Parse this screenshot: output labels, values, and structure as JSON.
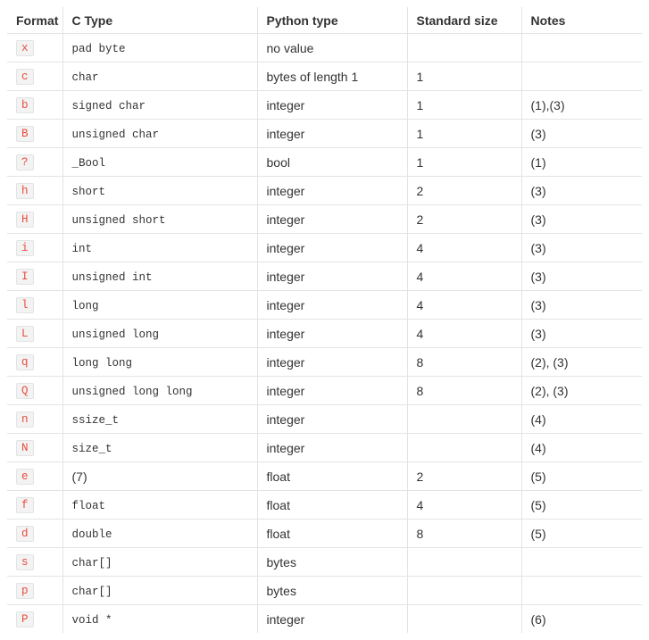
{
  "table": {
    "headers": [
      "Format",
      "C Type",
      "Python type",
      "Standard size",
      "Notes"
    ],
    "rows": [
      {
        "format": "x",
        "ctype": "pad byte",
        "ctype_mono": true,
        "ptype": "no value",
        "size": "",
        "notes": ""
      },
      {
        "format": "c",
        "ctype": "char",
        "ctype_mono": true,
        "ptype": "bytes of length 1",
        "size": "1",
        "notes": ""
      },
      {
        "format": "b",
        "ctype": "signed char",
        "ctype_mono": true,
        "ptype": "integer",
        "size": "1",
        "notes": "(1),(3)"
      },
      {
        "format": "B",
        "ctype": "unsigned char",
        "ctype_mono": true,
        "ptype": "integer",
        "size": "1",
        "notes": "(3)"
      },
      {
        "format": "?",
        "ctype": "_Bool",
        "ctype_mono": true,
        "ptype": "bool",
        "size": "1",
        "notes": "(1)"
      },
      {
        "format": "h",
        "ctype": "short",
        "ctype_mono": true,
        "ptype": "integer",
        "size": "2",
        "notes": "(3)"
      },
      {
        "format": "H",
        "ctype": "unsigned short",
        "ctype_mono": true,
        "ptype": "integer",
        "size": "2",
        "notes": "(3)"
      },
      {
        "format": "i",
        "ctype": "int",
        "ctype_mono": true,
        "ptype": "integer",
        "size": "4",
        "notes": "(3)"
      },
      {
        "format": "I",
        "ctype": "unsigned int",
        "ctype_mono": true,
        "ptype": "integer",
        "size": "4",
        "notes": "(3)"
      },
      {
        "format": "l",
        "ctype": "long",
        "ctype_mono": true,
        "ptype": "integer",
        "size": "4",
        "notes": "(3)"
      },
      {
        "format": "L",
        "ctype": "unsigned long",
        "ctype_mono": true,
        "ptype": "integer",
        "size": "4",
        "notes": "(3)"
      },
      {
        "format": "q",
        "ctype": "long long",
        "ctype_mono": true,
        "ptype": "integer",
        "size": "8",
        "notes": "(2), (3)"
      },
      {
        "format": "Q",
        "ctype": "unsigned long long",
        "ctype_mono": true,
        "ptype": "integer",
        "size": "8",
        "notes": "(2), (3)"
      },
      {
        "format": "n",
        "ctype": "ssize_t",
        "ctype_mono": true,
        "ptype": "integer",
        "size": "",
        "notes": "(4)"
      },
      {
        "format": "N",
        "ctype": "size_t",
        "ctype_mono": true,
        "ptype": "integer",
        "size": "",
        "notes": "(4)"
      },
      {
        "format": "e",
        "ctype": "(7)",
        "ctype_mono": false,
        "ptype": "float",
        "size": "2",
        "notes": "(5)"
      },
      {
        "format": "f",
        "ctype": "float",
        "ctype_mono": true,
        "ptype": "float",
        "size": "4",
        "notes": "(5)"
      },
      {
        "format": "d",
        "ctype": "double",
        "ctype_mono": true,
        "ptype": "float",
        "size": "8",
        "notes": "(5)"
      },
      {
        "format": "s",
        "ctype": "char[]",
        "ctype_mono": true,
        "ptype": "bytes",
        "size": "",
        "notes": ""
      },
      {
        "format": "p",
        "ctype": "char[]",
        "ctype_mono": true,
        "ptype": "bytes",
        "size": "",
        "notes": ""
      },
      {
        "format": "P",
        "ctype": "void *",
        "ctype_mono": true,
        "ptype": "integer",
        "size": "",
        "notes": "(6)"
      }
    ]
  }
}
